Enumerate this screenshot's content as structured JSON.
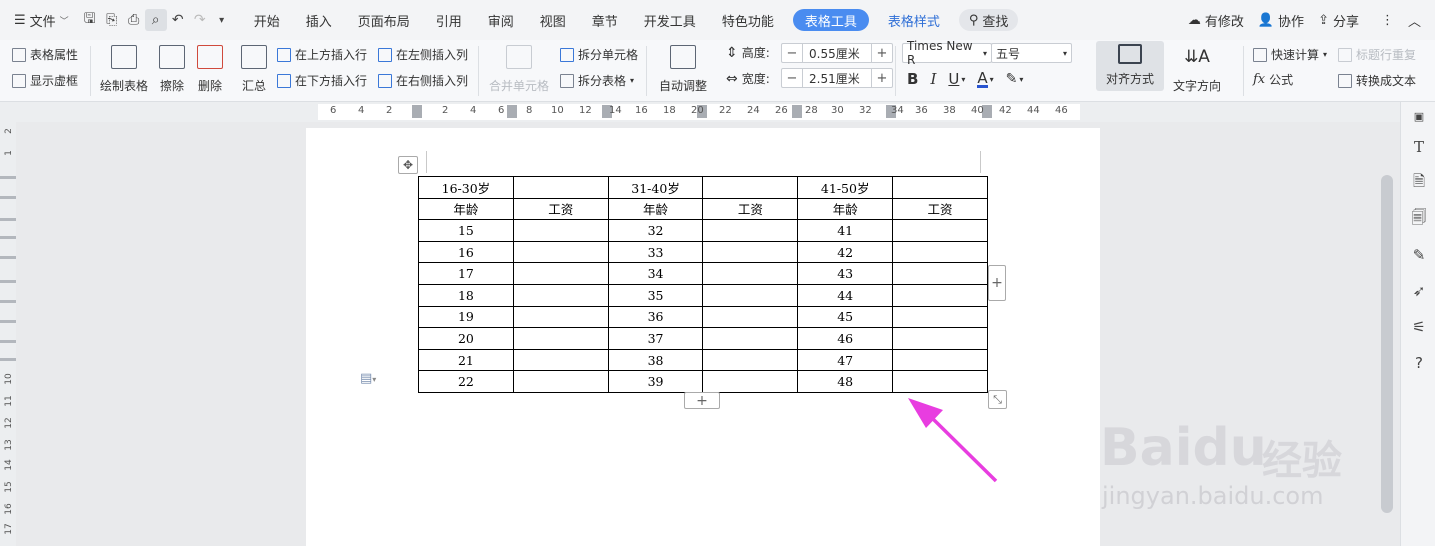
{
  "menubar": {
    "file_label": "文件",
    "tabs": [
      "开始",
      "插入",
      "页面布局",
      "引用",
      "审阅",
      "视图",
      "章节",
      "开发工具",
      "特色功能"
    ],
    "active_tab": "表格工具",
    "style_tab": "表格样式",
    "search_label": "查找",
    "modified_label": "有修改",
    "collab_label": "协作",
    "share_label": "分享"
  },
  "ribbon": {
    "table_props": "表格属性",
    "show_gridlines": "显示虚框",
    "draw_table": "绘制表格",
    "erase": "擦除",
    "delete": "删除",
    "summary": "汇总",
    "insert_above": "在上方插入行",
    "insert_below": "在下方插入行",
    "insert_left": "在左侧插入列",
    "insert_right": "在右侧插入列",
    "merge_cells": "合并单元格",
    "split_cells": "拆分单元格",
    "split_table": "拆分表格",
    "auto_adjust": "自动调整",
    "height_label": "高度:",
    "height_value": "0.55厘米",
    "width_label": "宽度:",
    "width_value": "2.51厘米",
    "font_name": "Times New R",
    "font_size": "五号",
    "align_label": "对齐方式",
    "text_dir_label": "文字方向",
    "quick_calc": "快速计算",
    "repeat_header": "标题行重复",
    "formula": "公式",
    "to_text": "转换成文本"
  },
  "ruler": {
    "ticks": [
      "6",
      "4",
      "2",
      "2",
      "4",
      "6",
      "8",
      "10",
      "12",
      "14",
      "16",
      "18",
      "20",
      "22",
      "24",
      "26",
      "28",
      "30",
      "32",
      "34",
      "36",
      "38",
      "40",
      "42",
      "44",
      "46"
    ]
  },
  "vruler": {
    "ticks": [
      "2",
      "1",
      "10",
      "11",
      "12",
      "13",
      "14",
      "15",
      "16",
      "17"
    ]
  },
  "table": {
    "header1": [
      "16-30岁",
      "",
      "31-40岁",
      "",
      "41-50岁",
      ""
    ],
    "header2": [
      "年龄",
      "工资",
      "年龄",
      "工资",
      "年龄",
      "工资"
    ],
    "rows": [
      [
        "15",
        "",
        "32",
        "",
        "41",
        ""
      ],
      [
        "16",
        "",
        "33",
        "",
        "42",
        ""
      ],
      [
        "17",
        "",
        "34",
        "",
        "43",
        ""
      ],
      [
        "18",
        "",
        "35",
        "",
        "44",
        ""
      ],
      [
        "19",
        "",
        "36",
        "",
        "45",
        ""
      ],
      [
        "20",
        "",
        "37",
        "",
        "46",
        ""
      ],
      [
        "21",
        "",
        "38",
        "",
        "47",
        ""
      ],
      [
        "22",
        "",
        "39",
        "",
        "48",
        ""
      ]
    ]
  },
  "watermark": {
    "brand": "Baidu",
    "brand_cn": "经验",
    "url": "jingyan.baidu.com"
  },
  "colors": {
    "accent": "#4a8cf0",
    "arrow": "#e83de0"
  }
}
